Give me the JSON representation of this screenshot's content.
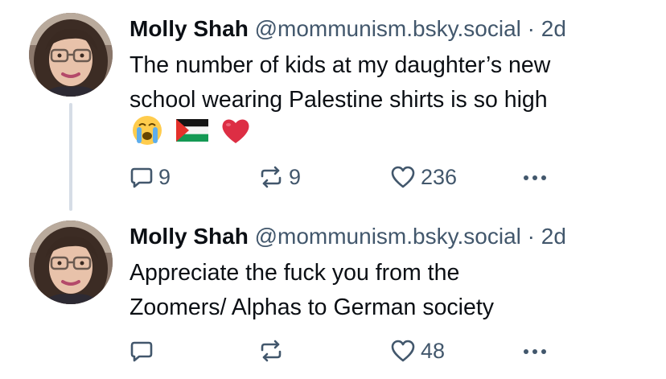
{
  "posts": [
    {
      "author_name": "Molly Shah",
      "handle": "@mommunism.bsky.social",
      "separator": "·",
      "time": "2d",
      "text_lines": [
        "The number of kids at my daughter’s new",
        "school wearing Palestine shirts is so high"
      ],
      "emojis": [
        "crying-face-emoji",
        "palestine-flag-emoji",
        "red-heart-emoji"
      ],
      "reply_count": "9",
      "repost_count": "9",
      "like_count": "236"
    },
    {
      "author_name": "Molly Shah",
      "handle": "@mommunism.bsky.social",
      "separator": "·",
      "time": "2d",
      "text_lines": [
        "Appreciate the fuck you from the",
        "Zoomers/ Alphas to German society"
      ],
      "like_count": "48"
    }
  ],
  "colors": {
    "text_primary": "#0b0f14",
    "text_secondary": "#42576c",
    "thread_line": "#d6dde6",
    "heart_red": "#dd2e44"
  }
}
